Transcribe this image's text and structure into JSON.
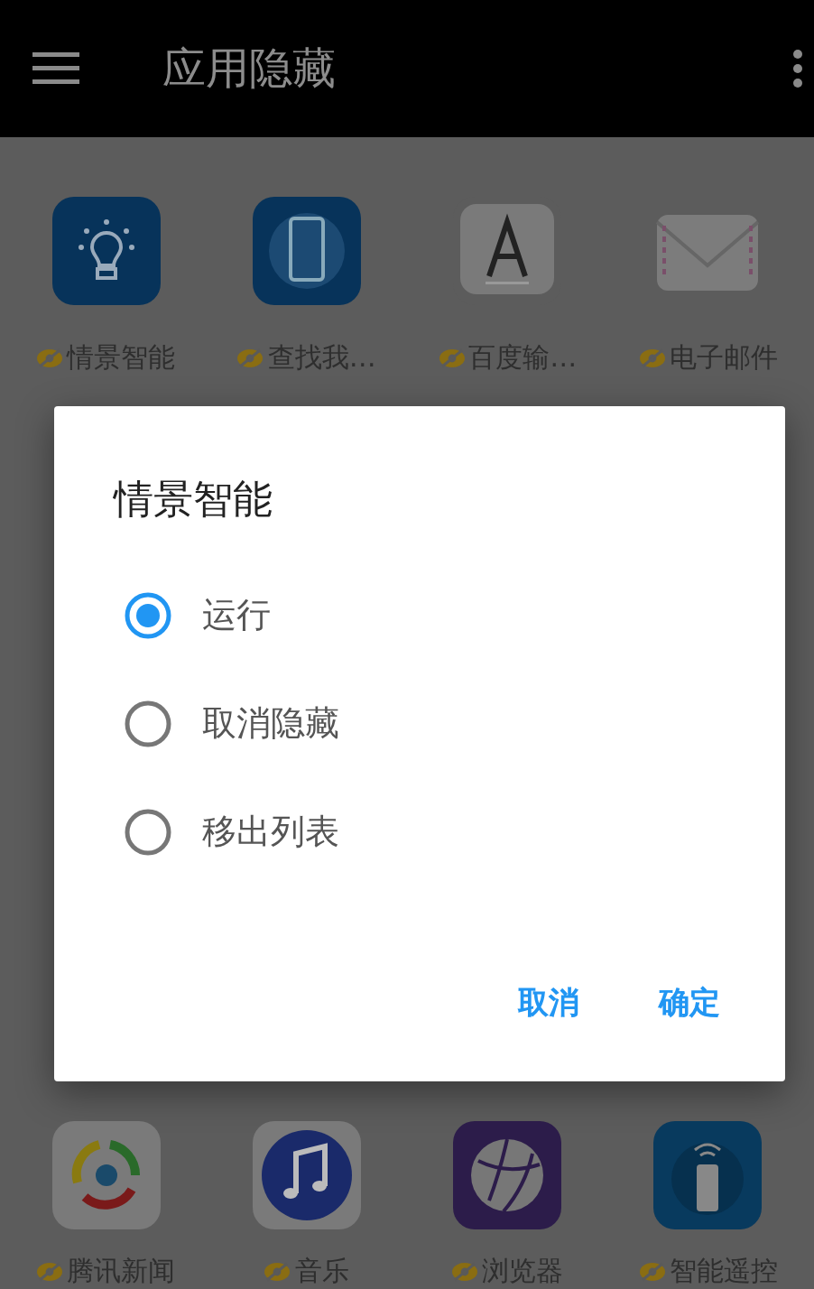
{
  "app_bar": {
    "title": "应用隐藏"
  },
  "top_apps": [
    {
      "name": "情景智能",
      "kind": "bulb",
      "hidden": true
    },
    {
      "name": "查找我…",
      "kind": "phone",
      "hidden": true
    },
    {
      "name": "百度输…",
      "kind": "keyboard",
      "hidden": true
    },
    {
      "name": "电子邮件",
      "kind": "mail",
      "hidden": true
    }
  ],
  "dialog": {
    "title": "情景智能",
    "options": [
      {
        "label": "运行",
        "selected": true
      },
      {
        "label": "取消隐藏",
        "selected": false
      },
      {
        "label": "移出列表",
        "selected": false
      }
    ],
    "buttons": [
      "取消",
      "确定"
    ]
  },
  "bottom_apps": [
    {
      "name": "腾讯新闻",
      "kind": "news",
      "hidden": true
    },
    {
      "name": "音乐",
      "kind": "music",
      "hidden": true
    },
    {
      "name": "浏览器",
      "kind": "browser",
      "hidden": true
    },
    {
      "name": "智能遥控",
      "kind": "remote",
      "hidden": true
    }
  ]
}
